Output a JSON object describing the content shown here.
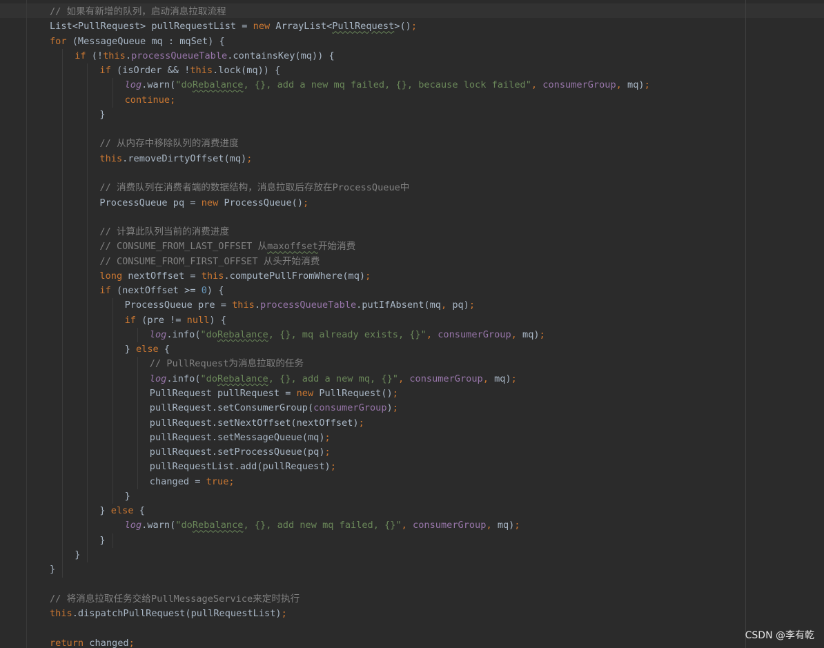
{
  "editor": {
    "lines": [
      {
        "indent": 0,
        "tokens": [
          [
            "cmt",
            "// 如果有新增的队列，启动消息拉取流程"
          ]
        ]
      },
      {
        "indent": 0,
        "tokens": [
          [
            "plain",
            "List<PullRequest> pullRequestList = "
          ],
          [
            "kw",
            "new "
          ],
          [
            "plain",
            "ArrayList<"
          ],
          [
            "sq",
            "PullRequest"
          ],
          [
            "plain",
            ">()"
          ],
          [
            "kw",
            ";"
          ]
        ]
      },
      {
        "indent": 0,
        "tokens": [
          [
            "kw",
            "for "
          ],
          [
            "plain",
            "(MessageQueue mq : mqSet) {"
          ]
        ]
      },
      {
        "indent": 1,
        "tokens": [
          [
            "kw",
            "if "
          ],
          [
            "plain",
            "(!"
          ],
          [
            "kw",
            "this"
          ],
          [
            "plain",
            "."
          ],
          [
            "fld",
            "processQueueTable"
          ],
          [
            "plain",
            ".containsKey(mq)) {"
          ]
        ]
      },
      {
        "indent": 2,
        "tokens": [
          [
            "kw",
            "if "
          ],
          [
            "plain",
            "(isOrder && !"
          ],
          [
            "kw",
            "this"
          ],
          [
            "plain",
            ".lock(mq)) {"
          ]
        ]
      },
      {
        "indent": 3,
        "tokens": [
          [
            "fld-it",
            "log"
          ],
          [
            "plain",
            ".warn("
          ],
          [
            "str",
            "\"do"
          ],
          [
            "str-sq",
            "Rebalance"
          ],
          [
            "str",
            ", {}, add a new mq failed, {}, because lock failed\""
          ],
          [
            "kw",
            ", "
          ],
          [
            "fld",
            "consumerGroup"
          ],
          [
            "kw",
            ", "
          ],
          [
            "plain",
            "mq)"
          ],
          [
            "kw",
            ";"
          ]
        ]
      },
      {
        "indent": 3,
        "tokens": [
          [
            "kw",
            "continue;"
          ]
        ]
      },
      {
        "indent": 2,
        "tokens": [
          [
            "plain",
            "}"
          ]
        ]
      },
      {
        "indent": 0,
        "tokens": []
      },
      {
        "indent": 2,
        "tokens": [
          [
            "cmt",
            "// 从内存中移除队列的消费进度"
          ]
        ]
      },
      {
        "indent": 2,
        "tokens": [
          [
            "kw",
            "this"
          ],
          [
            "plain",
            ".removeDirtyOffset(mq)"
          ],
          [
            "kw",
            ";"
          ]
        ]
      },
      {
        "indent": 0,
        "tokens": []
      },
      {
        "indent": 2,
        "tokens": [
          [
            "cmt",
            "// 消费队列在消费者端的数据结构，消息拉取后存放在ProcessQueue中"
          ]
        ]
      },
      {
        "indent": 2,
        "tokens": [
          [
            "plain",
            "ProcessQueue pq = "
          ],
          [
            "kw",
            "new "
          ],
          [
            "plain",
            "ProcessQueue()"
          ],
          [
            "kw",
            ";"
          ]
        ]
      },
      {
        "indent": 0,
        "tokens": []
      },
      {
        "indent": 2,
        "tokens": [
          [
            "cmt",
            "// 计算此队列当前的消费进度"
          ]
        ]
      },
      {
        "indent": 2,
        "tokens": [
          [
            "cmt",
            "// CONSUME_FROM_LAST_OFFSET 从"
          ],
          [
            "cmt-sq",
            "maxoffset"
          ],
          [
            "cmt",
            "开始消费"
          ]
        ]
      },
      {
        "indent": 2,
        "tokens": [
          [
            "cmt",
            "// CONSUME_FROM_FIRST_OFFSET 从头开始消费"
          ]
        ]
      },
      {
        "indent": 2,
        "tokens": [
          [
            "kw",
            "long "
          ],
          [
            "plain",
            "nextOffset = "
          ],
          [
            "kw",
            "this"
          ],
          [
            "plain",
            ".computePullFromWhere(mq)"
          ],
          [
            "kw",
            ";"
          ]
        ]
      },
      {
        "indent": 2,
        "tokens": [
          [
            "kw",
            "if "
          ],
          [
            "plain",
            "(nextOffset >= "
          ],
          [
            "num",
            "0"
          ],
          [
            "plain",
            ") {"
          ]
        ]
      },
      {
        "indent": 3,
        "tokens": [
          [
            "plain",
            "ProcessQueue pre = "
          ],
          [
            "kw",
            "this"
          ],
          [
            "plain",
            "."
          ],
          [
            "fld",
            "processQueueTable"
          ],
          [
            "plain",
            ".putIfAbsent(mq"
          ],
          [
            "kw",
            ", "
          ],
          [
            "plain",
            "pq)"
          ],
          [
            "kw",
            ";"
          ]
        ]
      },
      {
        "indent": 3,
        "tokens": [
          [
            "kw",
            "if "
          ],
          [
            "plain",
            "(pre != "
          ],
          [
            "kw",
            "null"
          ],
          [
            "plain",
            ") {"
          ]
        ]
      },
      {
        "indent": 4,
        "tokens": [
          [
            "fld-it",
            "log"
          ],
          [
            "plain",
            ".info("
          ],
          [
            "str",
            "\"do"
          ],
          [
            "str-sq",
            "Rebalance"
          ],
          [
            "str",
            ", {}, mq already exists, {}\""
          ],
          [
            "kw",
            ", "
          ],
          [
            "fld",
            "consumerGroup"
          ],
          [
            "kw",
            ", "
          ],
          [
            "plain",
            "mq)"
          ],
          [
            "kw",
            ";"
          ]
        ]
      },
      {
        "indent": 3,
        "tokens": [
          [
            "plain",
            "} "
          ],
          [
            "kw",
            "else "
          ],
          [
            "plain",
            "{"
          ]
        ]
      },
      {
        "indent": 4,
        "tokens": [
          [
            "cmt",
            "// PullRequest为消息拉取的任务"
          ]
        ]
      },
      {
        "indent": 4,
        "tokens": [
          [
            "fld-it",
            "log"
          ],
          [
            "plain",
            ".info("
          ],
          [
            "str",
            "\"do"
          ],
          [
            "str-sq",
            "Rebalance"
          ],
          [
            "str",
            ", {}, add a new mq, {}\""
          ],
          [
            "kw",
            ", "
          ],
          [
            "fld",
            "consumerGroup"
          ],
          [
            "kw",
            ", "
          ],
          [
            "plain",
            "mq)"
          ],
          [
            "kw",
            ";"
          ]
        ]
      },
      {
        "indent": 4,
        "tokens": [
          [
            "plain",
            "PullRequest pullRequest = "
          ],
          [
            "kw",
            "new "
          ],
          [
            "plain",
            "PullRequest()"
          ],
          [
            "kw",
            ";"
          ]
        ]
      },
      {
        "indent": 4,
        "tokens": [
          [
            "plain",
            "pullRequest.setConsumerGroup("
          ],
          [
            "fld",
            "consumerGroup"
          ],
          [
            "plain",
            ")"
          ],
          [
            "kw",
            ";"
          ]
        ]
      },
      {
        "indent": 4,
        "tokens": [
          [
            "plain",
            "pullRequest.setNextOffset(nextOffset)"
          ],
          [
            "kw",
            ";"
          ]
        ]
      },
      {
        "indent": 4,
        "tokens": [
          [
            "plain",
            "pullRequest.setMessageQueue(mq)"
          ],
          [
            "kw",
            ";"
          ]
        ]
      },
      {
        "indent": 4,
        "tokens": [
          [
            "plain",
            "pullRequest.setProcessQueue(pq)"
          ],
          [
            "kw",
            ";"
          ]
        ]
      },
      {
        "indent": 4,
        "tokens": [
          [
            "plain",
            "pullRequestList.add(pullRequest)"
          ],
          [
            "kw",
            ";"
          ]
        ]
      },
      {
        "indent": 4,
        "tokens": [
          [
            "plain",
            "changed = "
          ],
          [
            "kw",
            "true;"
          ]
        ]
      },
      {
        "indent": 3,
        "tokens": [
          [
            "plain",
            "}"
          ]
        ]
      },
      {
        "indent": 2,
        "tokens": [
          [
            "plain",
            "} "
          ],
          [
            "kw",
            "else "
          ],
          [
            "plain",
            "{"
          ]
        ]
      },
      {
        "indent": 3,
        "tokens": [
          [
            "fld-it",
            "log"
          ],
          [
            "plain",
            ".warn("
          ],
          [
            "str",
            "\"do"
          ],
          [
            "str-sq",
            "Rebalance"
          ],
          [
            "str",
            ", {}, add new mq failed, {}\""
          ],
          [
            "kw",
            ", "
          ],
          [
            "fld",
            "consumerGroup"
          ],
          [
            "kw",
            ", "
          ],
          [
            "plain",
            "mq)"
          ],
          [
            "kw",
            ";"
          ]
        ]
      },
      {
        "indent": 2,
        "tokens": [
          [
            "plain",
            "}"
          ]
        ]
      },
      {
        "indent": 1,
        "tokens": [
          [
            "plain",
            "}"
          ]
        ]
      },
      {
        "indent": 0,
        "tokens": [
          [
            "plain",
            "}"
          ]
        ]
      },
      {
        "indent": 0,
        "tokens": []
      },
      {
        "indent": 0,
        "tokens": [
          [
            "cmt",
            "// 将消息拉取任务交给PullMessageService来定时执行"
          ]
        ]
      },
      {
        "indent": 0,
        "tokens": [
          [
            "kw",
            "this"
          ],
          [
            "plain",
            ".dispatchPullRequest(pullRequestList)"
          ],
          [
            "kw",
            ";"
          ]
        ]
      },
      {
        "indent": 0,
        "tokens": []
      },
      {
        "indent": 0,
        "tokens": [
          [
            "kw",
            "return "
          ],
          [
            "plain",
            "changed"
          ],
          [
            "kw",
            ";"
          ]
        ]
      }
    ]
  },
  "watermark": {
    "text": "CSDN @李有乾"
  }
}
